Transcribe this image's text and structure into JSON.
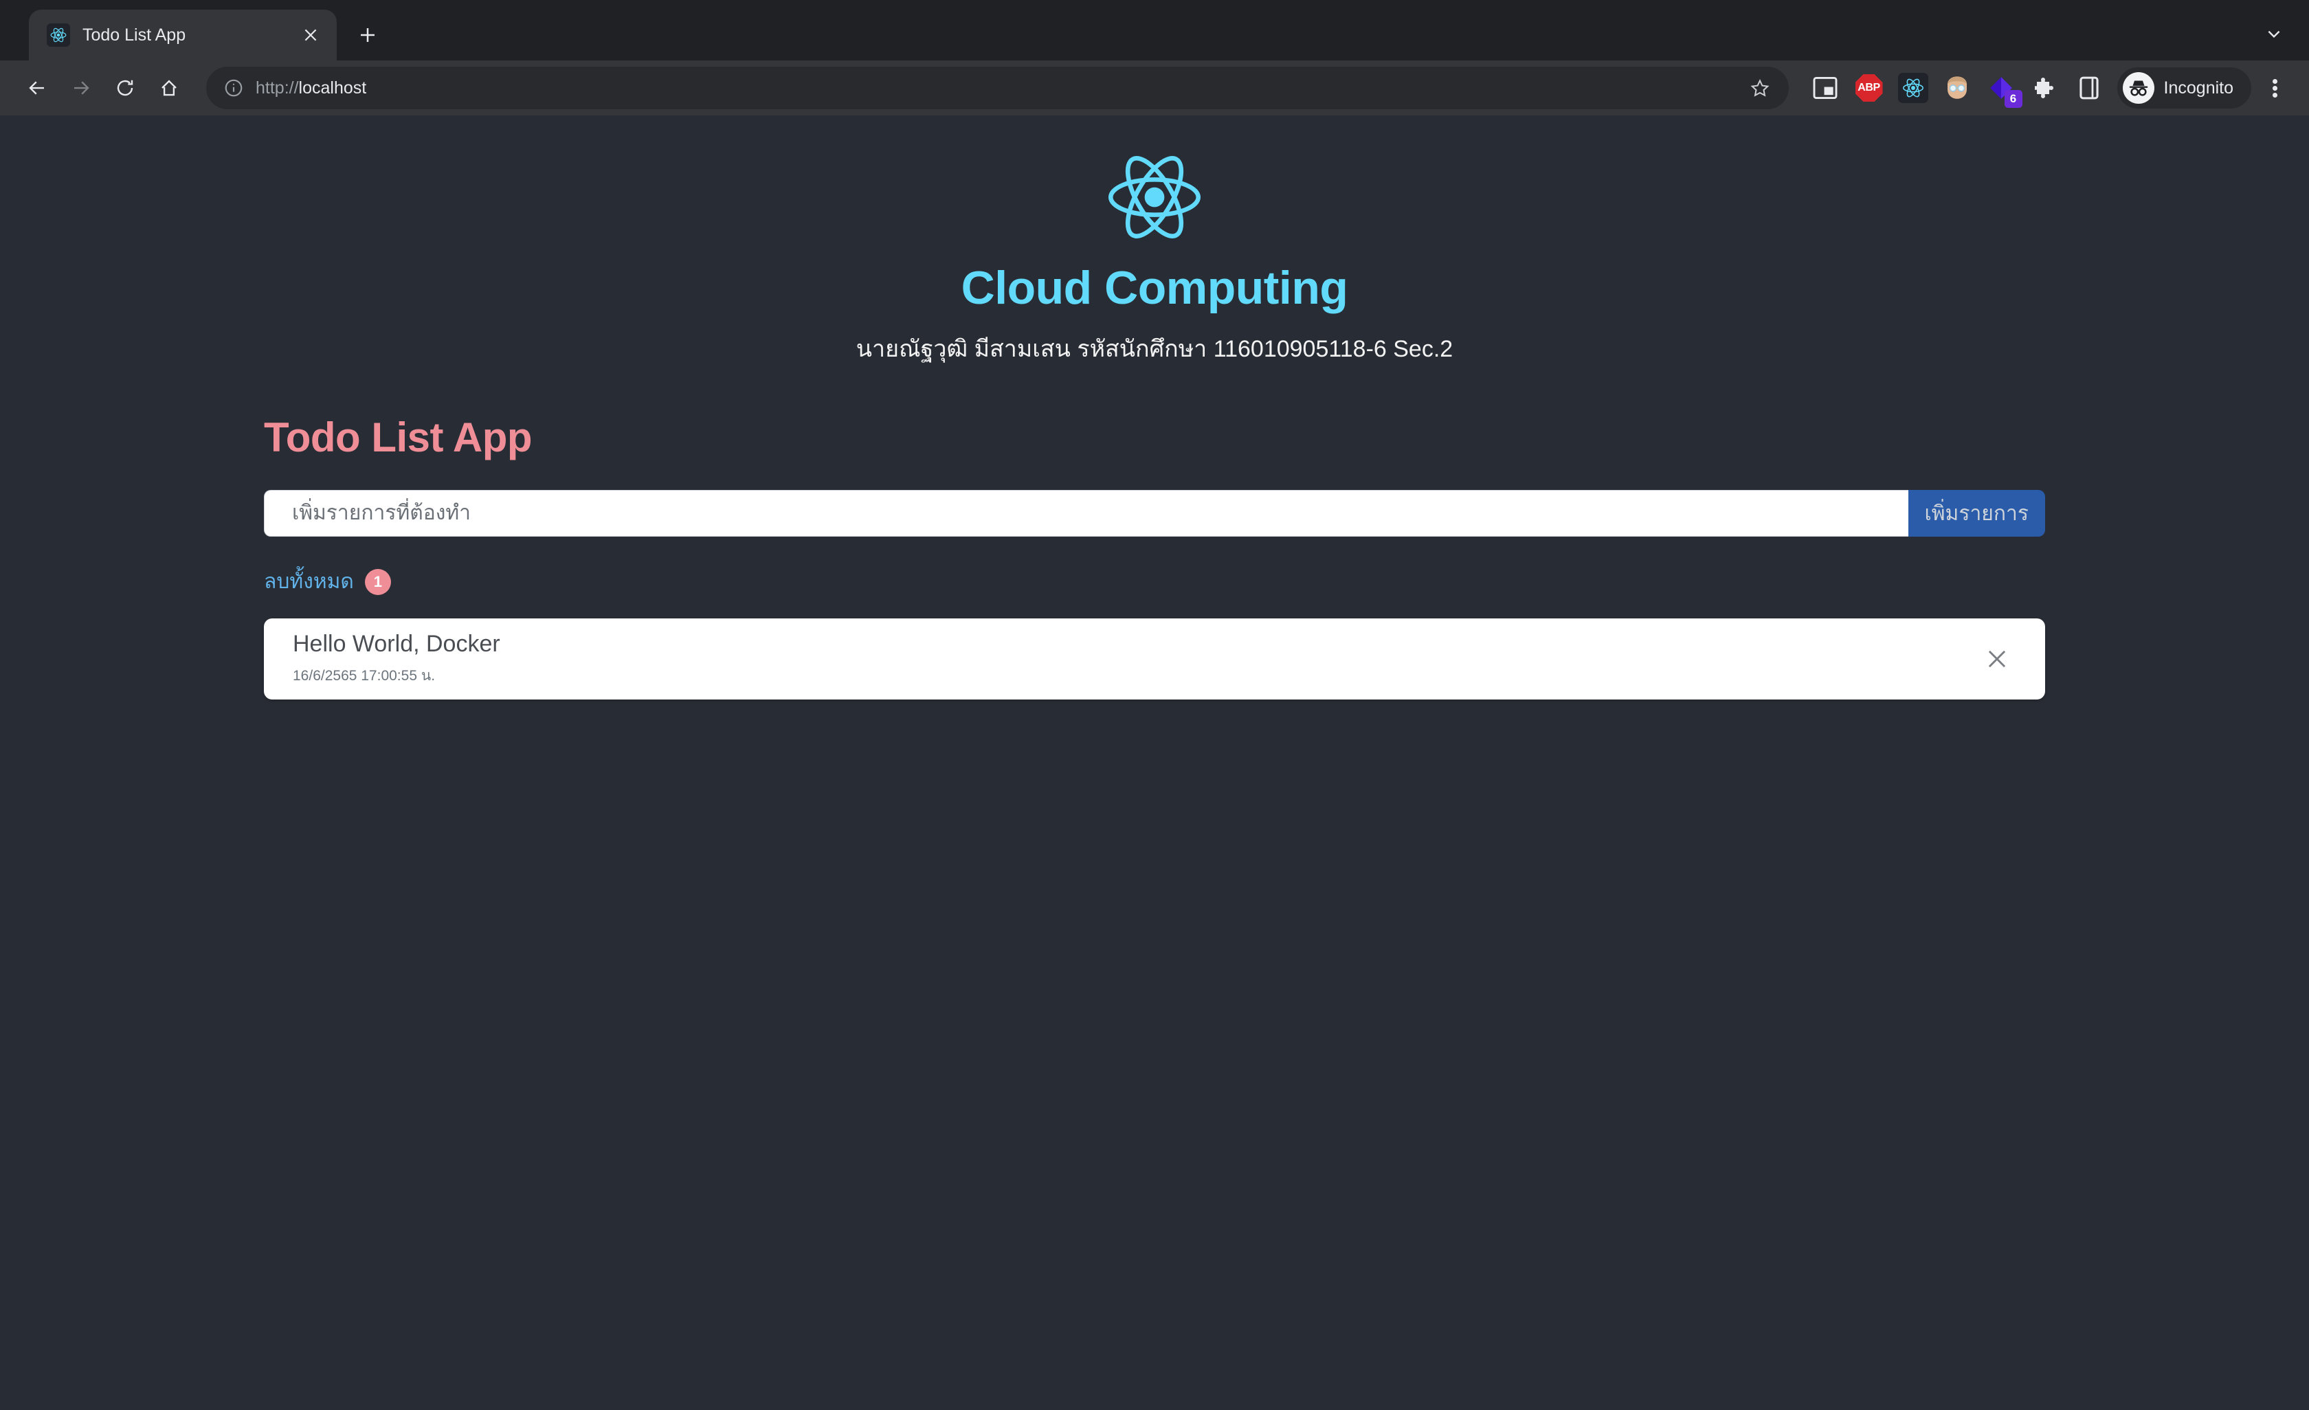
{
  "browser": {
    "tab": {
      "title": "Todo List App",
      "favicon_icon": "react-logo-icon",
      "close_icon": "close-icon"
    },
    "new_tab_icon": "plus-icon",
    "tab_list_icon": "chevron-down-icon",
    "nav": {
      "back_icon": "back-arrow-icon",
      "forward_icon": "forward-arrow-icon",
      "reload_icon": "reload-icon",
      "home_icon": "home-icon"
    },
    "omnibox": {
      "site_info_icon": "info-circle-icon",
      "url_scheme": "http://",
      "url_host": "localhost",
      "bookmark_icon": "star-icon"
    },
    "extensions": [
      {
        "name": "picture-in-picture-icon",
        "label": ""
      },
      {
        "name": "adblock-plus-icon",
        "label": "ABP"
      },
      {
        "name": "react-devtools-icon",
        "label": ""
      },
      {
        "name": "face-emoji-extension-icon",
        "label": ""
      },
      {
        "name": "purple-diamond-extension-icon",
        "label": "",
        "badge": "6"
      },
      {
        "name": "puzzle-extensions-icon",
        "label": ""
      },
      {
        "name": "side-panel-icon",
        "label": ""
      }
    ],
    "profile": {
      "avatar_icon": "incognito-icon",
      "label": "Incognito"
    },
    "menu_icon": "three-dot-menu-icon"
  },
  "page": {
    "logo_icon": "react-logo-icon",
    "heading": "Cloud Computing",
    "subheading": "นายณัฐวุฒิ มีสามเสน รหัสนักศึกษา 116010905118-6 Sec.2",
    "todo": {
      "title": "Todo List App",
      "input_placeholder": "เพิ่มรายการที่ต้องทำ",
      "input_value": "",
      "add_button": "เพิ่มรายการ",
      "clear_all_label": "ลบทั้งหมด",
      "count": "1",
      "items": [
        {
          "text": "Hello World, Docker",
          "date": "16/6/2565 17:00:55 น.",
          "delete_icon": "close-icon"
        }
      ]
    }
  },
  "colors": {
    "page_background": "#282c34",
    "accent_cyan": "#61dafb",
    "accent_pink": "#f08e98",
    "button_blue": "#2a5caa",
    "link_blue": "#61b2e8"
  }
}
